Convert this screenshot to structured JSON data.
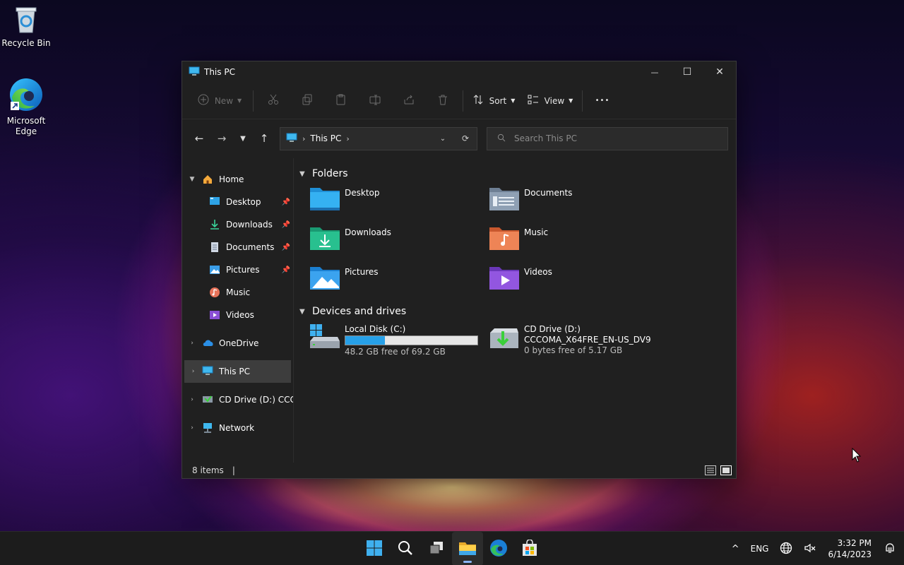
{
  "desktop": {
    "icons": [
      {
        "label": "Recycle Bin"
      },
      {
        "label": "Microsoft\nEdge",
        "line1": "Microsoft",
        "line2": "Edge"
      }
    ]
  },
  "window": {
    "title": "This PC",
    "controls": {
      "minimize": "—",
      "maximize": "☐",
      "close": "✕"
    }
  },
  "commandbar": {
    "new_label": "New",
    "sort_label": "Sort",
    "view_label": "View",
    "more_label": "•••"
  },
  "navbar": {
    "address": {
      "location": "This PC"
    },
    "search": {
      "placeholder": "Search This PC"
    }
  },
  "sidebar": {
    "home": "Home",
    "quick_access": [
      {
        "label": "Desktop"
      },
      {
        "label": "Downloads"
      },
      {
        "label": "Documents"
      },
      {
        "label": "Pictures"
      },
      {
        "label": "Music"
      },
      {
        "label": "Videos"
      }
    ],
    "onedrive": "OneDrive",
    "this_pc": "This PC",
    "cd_drive": "CD Drive (D:) CCCO",
    "network": "Network"
  },
  "content": {
    "folders_header": "Folders",
    "folders": [
      {
        "name": "Desktop"
      },
      {
        "name": "Documents"
      },
      {
        "name": "Downloads"
      },
      {
        "name": "Music"
      },
      {
        "name": "Pictures"
      },
      {
        "name": "Videos"
      }
    ],
    "drives_header": "Devices and drives",
    "drives": [
      {
        "name": "Local Disk (C:)",
        "free": "48.2 GB free of 69.2 GB",
        "used_fraction": 0.3
      },
      {
        "name": "CD Drive (D:)",
        "label": "CCCOMA_X64FRE_EN-US_DV9",
        "free": "0 bytes free of 5.17 GB"
      }
    ]
  },
  "statusbar": {
    "items": "8 items",
    "cursor": "|"
  },
  "taskbar": {
    "language": "ENG",
    "time": "3:32 PM",
    "date": "6/14/2023",
    "chevron": "^"
  },
  "colors": {
    "accent": "#27a0e8",
    "window_bg": "#202020",
    "taskbar_bg": "#1c1c1c"
  }
}
